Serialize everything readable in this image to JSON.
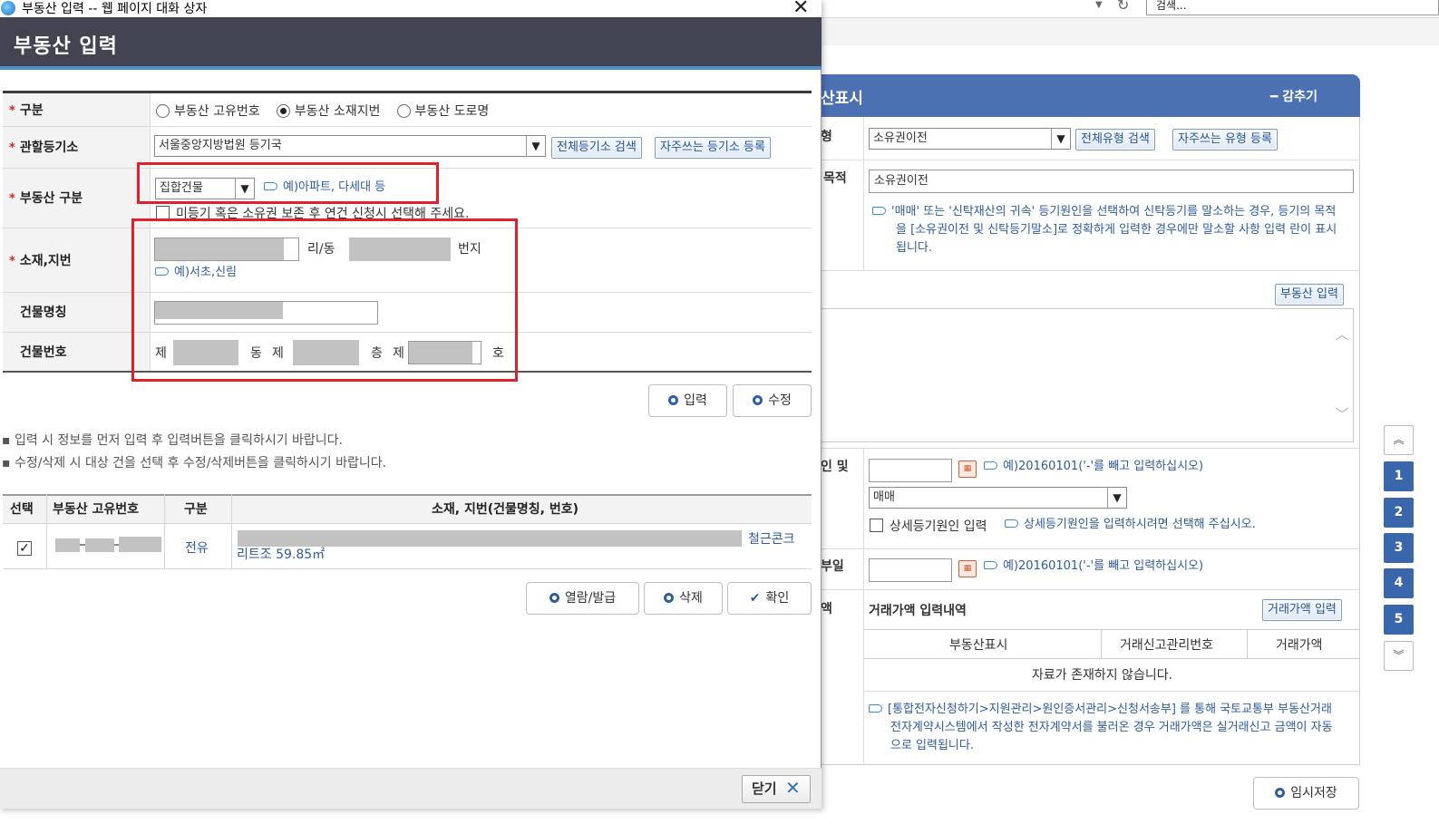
{
  "browser": {
    "search_placeholder": "검색..."
  },
  "background": {
    "panel_title": "산표시",
    "hide_label": "━ 감추기",
    "row_frag_1": "형",
    "row_frag_2": "목적",
    "row_frag_3": "인 및",
    "row_frag_4": "부일",
    "row_frag_5": "액",
    "cause_select": "소유권이전",
    "all_type_search": "전체유형 검색",
    "fav_type_register": "자주쓰는 유형 등록",
    "purpose_input": "소유권이전",
    "purpose_note": "'매매' 또는 '신탁재산의 귀속' 등기원인을 선택하여 신탁등기를 말소하는 경우, 등기의 목적을 [소유권이전 및 신탁등기말소]로 정확하게 입력한 경우에만 말소할 사항 입력 란이 표시됩니다.",
    "property_input_btn": "부동산 입력",
    "date_hint_1": "예)20160101('-'를 빼고 입력하십시오)",
    "cause_type_select": "매매",
    "detail_cause_label": "상세등기원인 입력",
    "detail_cause_hint": "상세등기원인을 입력하시려면 선택해 주십시오.",
    "date_hint_2": "예)20160101('-'를 빼고 입력하십시오)",
    "price_title": "거래가액 입력내역",
    "price_input_btn": "거래가액 입력",
    "price_cols": [
      "부동산표시",
      "거래신고관리번호",
      "거래가액"
    ],
    "no_data": "자료가 존재하지 않습니다.",
    "price_note": "[통합전자신청하기>지원관리>원인증서관리>신청서송부] 를 통해 국토교통부 부동산거래 전자계약시스템에서 작성한 전자계약서를 불러온 경우 거래가액은 실거래신고 금액이 자동으로 입력됩니다.",
    "temp_save": "임시저장",
    "pager": [
      "1",
      "2",
      "3",
      "4",
      "5"
    ]
  },
  "dialog": {
    "window_title": "부동산 입력 -- 웹 페이지 대화 상자",
    "heading": "부동산 입력",
    "labels": {
      "type": "구분",
      "registry": "관할등기소",
      "property_type": "부동산 구분",
      "address": "소재,지번",
      "building_name": "건물명칭",
      "building_number": "건물번호"
    },
    "required_mark": "*",
    "radio_options": [
      "부동산 고유번호",
      "부동산 소재지번",
      "부동산 도로명"
    ],
    "registry_select": "서울중앙지방법원 등기국",
    "all_registry_search": "전체등기소 검색",
    "fav_registry_register": "자주쓰는 등기소 등록",
    "property_type_select": "집합건물",
    "property_type_hint": "예)아파트, 다세대 등",
    "unregistered_label": "미등기 혹은 소유권 보존 후 연건 신청시 선택해 주세요.",
    "ri_dong": "리/동",
    "beonji": "번지",
    "address_hint": "예)서초,신림",
    "bldg_je1": "제",
    "bldg_dong": "동",
    "bldg_je2": "제",
    "bldg_cheung": "층",
    "bldg_je3": "제",
    "bldg_ho": "호",
    "input_btn": "입력",
    "edit_btn": "수정",
    "notice_1": "입력 시 정보를 먼저 입력 후 입력버튼을 클릭하시기 바랍니다.",
    "notice_2": "수정/삭제 시 대상 건을 선택 후 수정/삭제버튼을 클릭하시기 바랍니다.",
    "table_headers": [
      "선택",
      "부동산 고유번호",
      "구분",
      "소재, 지번(건물명칭, 번호)"
    ],
    "row": {
      "category": "전유",
      "structure_1": "철근콘크",
      "structure_2": "리트조 59.85㎡"
    },
    "view_issue_btn": "열람/발급",
    "delete_btn": "삭제",
    "confirm_btn": "확인",
    "close_btn": "닫기"
  }
}
